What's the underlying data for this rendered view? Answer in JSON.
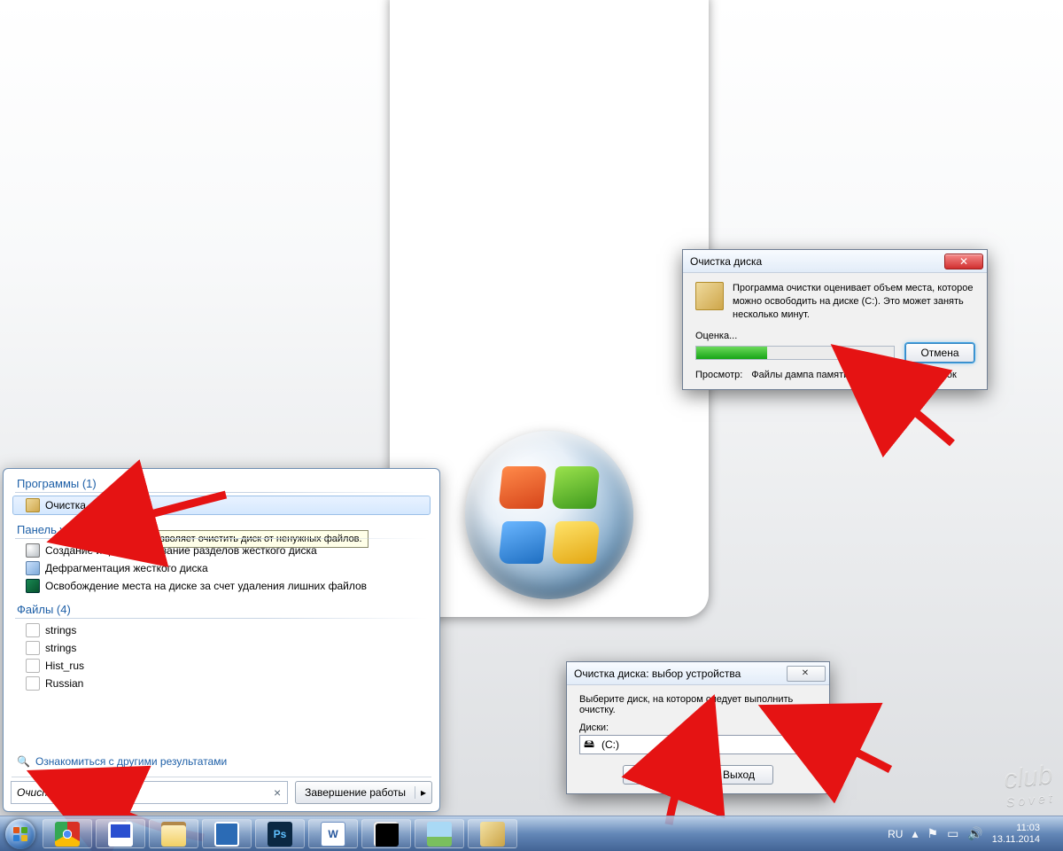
{
  "start_menu": {
    "programs_header": "Программы (1)",
    "program_item": "Очистка диска",
    "tooltip": "Позволяет очистить диск от ненужных файлов.",
    "control_panel_header": "Панель управления",
    "cp_items": [
      "Создание и форматирование разделов жесткого диска",
      "Дефрагментация жесткого диска",
      "Освобождение места на диске за счет удаления лишних файлов"
    ],
    "files_header": "Файлы (4)",
    "files": [
      "strings",
      "strings",
      "Hist_rus",
      "Russian"
    ],
    "more_results": "Ознакомиться с другими результатами",
    "search_value": "Очистка диска",
    "shutdown_label": "Завершение работы"
  },
  "select_dialog": {
    "title": "Очистка диска: выбор устройства",
    "body_text": "Выберите диск, на котором следует выполнить очистку.",
    "label_disks": "Диски:",
    "selected": "(C:)",
    "ok": "ОК",
    "exit": "Выход"
  },
  "progress_dialog": {
    "title": "Очистка диска",
    "body_text": "Программа очистки оценивает объем места, которое можно освободить на диске  (C:). Это может занять несколько минут.",
    "stage": "Оценка...",
    "cancel": "Отмена",
    "view_label": "Просмотр:",
    "view_value": "Файлы дампа памяти для системных ошибок",
    "progress_pct": 36
  },
  "taskbar": {
    "lang": "RU",
    "time": "11:03",
    "date": "13.11.2014"
  },
  "watermark": {
    "line1": "club",
    "line2": "Sovet"
  }
}
